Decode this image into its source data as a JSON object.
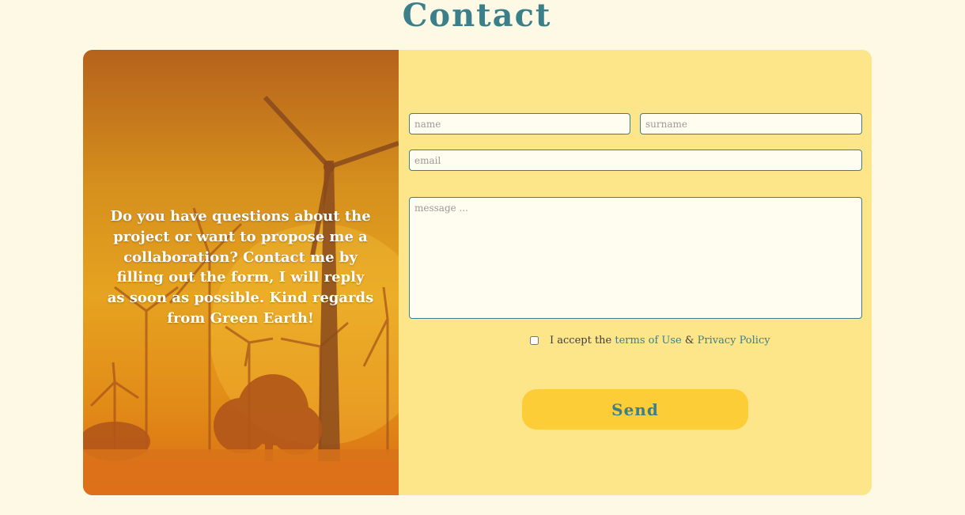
{
  "page": {
    "title": "Contact"
  },
  "image_panel": {
    "text": "Do you have questions about the project or want to propose me a collaboration? Contact me by filling out the form, I will reply as soon as possible. Kind regards from Green Earth!"
  },
  "form": {
    "name_placeholder": "name",
    "surname_placeholder": "surname",
    "email_placeholder": "email",
    "message_placeholder": "message ...",
    "terms_prefix": "I accept the",
    "terms_link": "terms of Use",
    "terms_separator": "&",
    "privacy_link": "Privacy Policy",
    "send_label": "Send"
  },
  "colors": {
    "background": "#fef9e4",
    "card": "#fde68a",
    "accent": "#3a7f8a",
    "button": "#fccd36"
  }
}
